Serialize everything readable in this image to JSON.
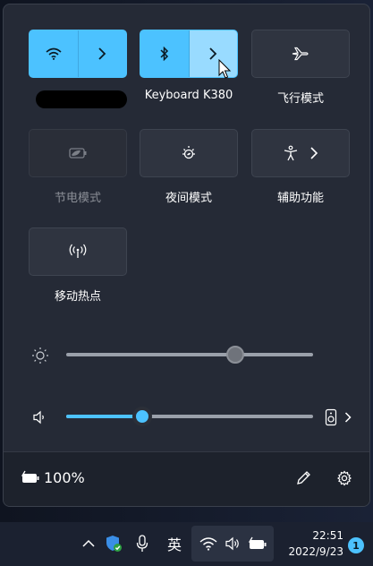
{
  "tiles": {
    "wifi": {
      "label": "",
      "active": true
    },
    "bluetooth": {
      "label": "Keyboard K380",
      "active": true
    },
    "airplane": {
      "label": "飞行模式",
      "active": false
    },
    "battery_saver": {
      "label": "节电模式",
      "active": false,
      "disabled": true
    },
    "night_light": {
      "label": "夜间模式",
      "active": false
    },
    "accessibility": {
      "label": "辅助功能",
      "active": false
    },
    "hotspot": {
      "label": "移动热点",
      "active": false
    }
  },
  "brightness": {
    "level_percent": 66
  },
  "volume": {
    "level_percent": 30
  },
  "footer": {
    "battery_text": "100%"
  },
  "taskbar": {
    "input_method": "英",
    "time": "22:51",
    "date": "2022/9/23",
    "notification_count": "1"
  },
  "colors": {
    "accent": "#4cc2ff",
    "panel": "#252a36",
    "tile": "#2f3440"
  },
  "icons": [
    "wifi-icon",
    "bluetooth-icon",
    "airplane-icon",
    "battery-saver-icon",
    "night-light-icon",
    "accessibility-icon",
    "hotspot-icon",
    "brightness-icon",
    "volume-icon",
    "speaker-device-icon",
    "edit-icon",
    "settings-icon",
    "chevron-up-icon",
    "security-icon",
    "microphone-icon"
  ]
}
